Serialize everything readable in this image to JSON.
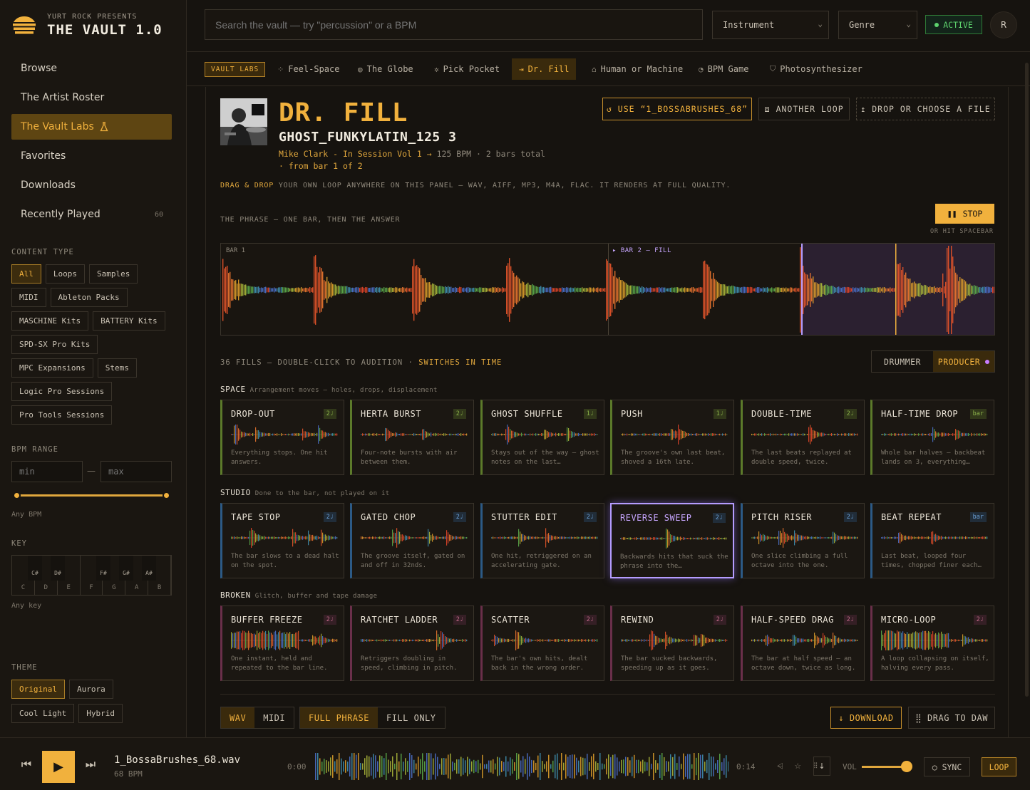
{
  "app": {
    "presents": "YURT ROCK PRESENTS",
    "title": "THE VAULT 1.0"
  },
  "nav": [
    {
      "label": "Browse"
    },
    {
      "label": "The Artist Roster"
    },
    {
      "label": "The Vault Labs",
      "active": true
    },
    {
      "label": "Favorites"
    },
    {
      "label": "Downloads"
    },
    {
      "label": "Recently Played",
      "count": "60"
    }
  ],
  "content_type": {
    "heading": "CONTENT TYPE",
    "chips": [
      "All",
      "Loops",
      "Samples",
      "MIDI",
      "Ableton Packs",
      "MASCHINE Kits",
      "BATTERY Kits",
      "SPD-SX Pro Kits",
      "MPC Expansions",
      "Stems",
      "Logic Pro Sessions",
      "Pro Tools Sessions"
    ],
    "selected": "All"
  },
  "bpm": {
    "heading": "BPM RANGE",
    "min_placeholder": "min",
    "max_placeholder": "max",
    "dash": "—",
    "hint": "Any BPM"
  },
  "key": {
    "heading": "KEY",
    "white": [
      "C",
      "D",
      "E",
      "F",
      "G",
      "A",
      "B"
    ],
    "black": [
      "C#",
      "D#",
      "F#",
      "G#",
      "A#"
    ],
    "hint": "Any key"
  },
  "theme": {
    "heading": "THEME",
    "options": [
      "Original",
      "Aurora",
      "Cool Light",
      "Hybrid"
    ],
    "selected": "Original"
  },
  "search": {
    "placeholder": "Search the vault — try \"percussion\" or a BPM"
  },
  "filters": {
    "instrument": "Instrument",
    "genre": "Genre"
  },
  "status": {
    "label": "ACTIVE",
    "color": "#5ed36d"
  },
  "avatar": "R",
  "labs": {
    "badge": "VAULT LABS",
    "tabs": [
      {
        "label": "Feel-Space",
        "icon": "⁘"
      },
      {
        "label": "The Globe",
        "icon": "◍"
      },
      {
        "label": "Pick Pocket",
        "icon": "✲"
      },
      {
        "label": "Dr. Fill",
        "icon": "⇥",
        "active": true
      },
      {
        "label": "Human or Machine",
        "icon": "⌂"
      },
      {
        "label": "BPM Game",
        "icon": "◔"
      },
      {
        "label": "Photosynthesizer",
        "icon": "⛉"
      }
    ]
  },
  "tool": {
    "title": "DR. FILL",
    "loop_name": "GHOST_FUNKYLATIN_125 3",
    "artist": "Mike Clark - In Session Vol 1 →",
    "bpm": "125 BPM",
    "bars": "· 2 bars total",
    "from": "· from bar 1 of 2",
    "use_button": "↺ USE “1_BOSSABRUSHES_68”",
    "another_button": "⧈ ANOTHER LOOP",
    "drop_button": "↥ DROP OR CHOOSE A FILE",
    "drag_lead": "DRAG & DROP",
    "drag_text": "YOUR OWN LOOP ANYWHERE ON THIS PANEL — WAV, AIFF, MP3, M4A, FLAC. IT RENDERS AT FULL QUALITY.",
    "phrase_heading": "THE PHRASE — ONE BAR, THEN THE ANSWER",
    "stop_label": "STOP",
    "spacebar_hint": "OR HIT SPACEBAR",
    "bar1_label": "BAR 1",
    "bar2_label": "▸ BAR 2 — FILL",
    "fills_heading": "36 FILLS — DOUBLE-CLICK TO AUDITION ·",
    "fills_switch": "SWITCHES IN TIME",
    "mode": [
      "DRUMMER",
      "PRODUCER"
    ],
    "mode_selected": "PRODUCER"
  },
  "groups": [
    {
      "name": "SPACE",
      "desc": "Arrangement moves — holes, drops, displacement",
      "color": "#5c7a2a",
      "badge_color": "#8bb04a",
      "cards": [
        {
          "name": "DROP-OUT",
          "badge": "2♩",
          "desc": "Everything stops. One hit answers."
        },
        {
          "name": "HERTA BURST",
          "badge": "2♩",
          "desc": "Four-note bursts with air between them."
        },
        {
          "name": "GHOST SHUFFLE",
          "badge": "1♩",
          "desc": "Stays out of the way — ghost notes on the last…"
        },
        {
          "name": "PUSH",
          "badge": "1♩",
          "desc": "The groove's own last beat, shoved a 16th late."
        },
        {
          "name": "DOUBLE-TIME",
          "badge": "2♩",
          "desc": "The last beats replayed at double speed, twice."
        },
        {
          "name": "HALF-TIME DROP",
          "badge": "bar",
          "desc": "Whole bar halves — backbeat lands on 3, everything…"
        }
      ]
    },
    {
      "name": "STUDIO",
      "desc": "Done to the bar, not played on it",
      "color": "#2c5a86",
      "badge_color": "#6b9fd4",
      "cards": [
        {
          "name": "TAPE STOP",
          "badge": "2♩",
          "desc": "The bar slows to a dead halt on the spot."
        },
        {
          "name": "GATED CHOP",
          "badge": "2♩",
          "desc": "The groove itself, gated on and off in 32nds."
        },
        {
          "name": "STUTTER EDIT",
          "badge": "2♩",
          "desc": "One hit, retriggered on an accelerating gate."
        },
        {
          "name": "REVERSE SWEEP",
          "badge": "2♩",
          "desc": "Backwards hits that suck the phrase into the…",
          "selected": true
        },
        {
          "name": "PITCH RISER",
          "badge": "2♩",
          "desc": "One slice climbing a full octave into the one."
        },
        {
          "name": "BEAT REPEAT",
          "badge": "bar",
          "desc": "Last beat, looped four times, chopped finer each…"
        }
      ]
    },
    {
      "name": "BROKEN",
      "desc": "Glitch, buffer and tape damage",
      "color": "#6a2f4a",
      "badge_color": "#c06a8a",
      "cards": [
        {
          "name": "BUFFER FREEZE",
          "badge": "2♩",
          "desc": "One instant, held and repeated to the bar line."
        },
        {
          "name": "RATCHET LADDER",
          "badge": "2♩",
          "desc": "Retriggers doubling in speed, climbing in pitch."
        },
        {
          "name": "SCATTER",
          "badge": "2♩",
          "desc": "The bar's own hits, dealt back in the wrong order."
        },
        {
          "name": "REWIND",
          "badge": "2♩",
          "desc": "The bar sucked backwards, speeding up as it goes."
        },
        {
          "name": "HALF-SPEED DRAG",
          "badge": "2♩",
          "desc": "The bar at half speed — an octave down, twice as long."
        },
        {
          "name": "MICRO-LOOP",
          "badge": "2♩",
          "desc": "A loop collapsing on itself, halving every pass."
        }
      ]
    }
  ],
  "export": {
    "format": [
      "WAV",
      "MIDI"
    ],
    "format_selected": "WAV",
    "scope": [
      "FULL PHRASE",
      "FILL ONLY"
    ],
    "scope_selected": "FULL PHRASE",
    "download": "↓ DOWNLOAD",
    "drag": "⣿ DRAG TO DAW"
  },
  "player": {
    "track": "1_BossaBrushes_68.wav",
    "bpm": "68 BPM",
    "time_start": "0:00",
    "time_end": "0:14",
    "vol_label": "VOL",
    "volume": 0.9,
    "sync": "○ SYNC",
    "loop": "LOOP",
    "icons": "⩤ ☆ ⠿",
    "download_icon": "↓"
  }
}
